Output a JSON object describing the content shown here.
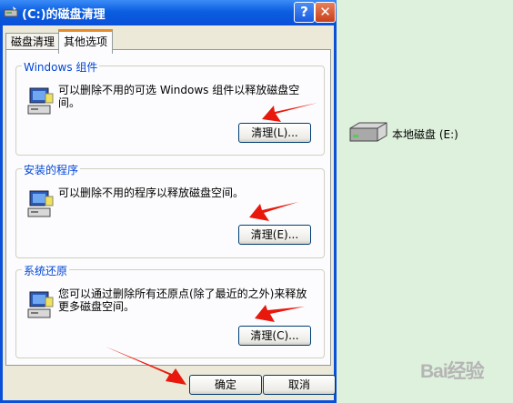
{
  "window": {
    "title": "(C:)的磁盘清理",
    "help_label": "?",
    "close_label": "✕"
  },
  "tabs": [
    {
      "label": "磁盘清理"
    },
    {
      "label": "其他选项"
    }
  ],
  "groups": [
    {
      "label": "Windows 组件",
      "description": "可以删除不用的可选 Windows 组件以释放磁盘空\n间。",
      "button": "清理(L)..."
    },
    {
      "label": "安装的程序",
      "description": "可以删除不用的程序以释放磁盘空间。",
      "button": "清理(E)..."
    },
    {
      "label": "系统还原",
      "description": "您可以通过删除所有还原点(除了最近的之外)来释放更多磁盘空间。",
      "button": "清理(C)..."
    }
  ],
  "footer": {
    "ok_label": "确定",
    "cancel_label": "取消"
  },
  "desktop": {
    "drive_label": "本地磁盘 (E:)"
  },
  "watermark": "Bai经验",
  "icons": [
    "disk-cleanup-icon",
    "help-icon",
    "close-icon",
    "computer-icon",
    "hard-drive-icon",
    "red-arrow"
  ],
  "colors": {
    "titlebar": "#0a50d8",
    "dialog": "#ece9d8",
    "group_label": "#0046d5",
    "arrow": "#e8190c",
    "desktop": "#def1dc"
  }
}
